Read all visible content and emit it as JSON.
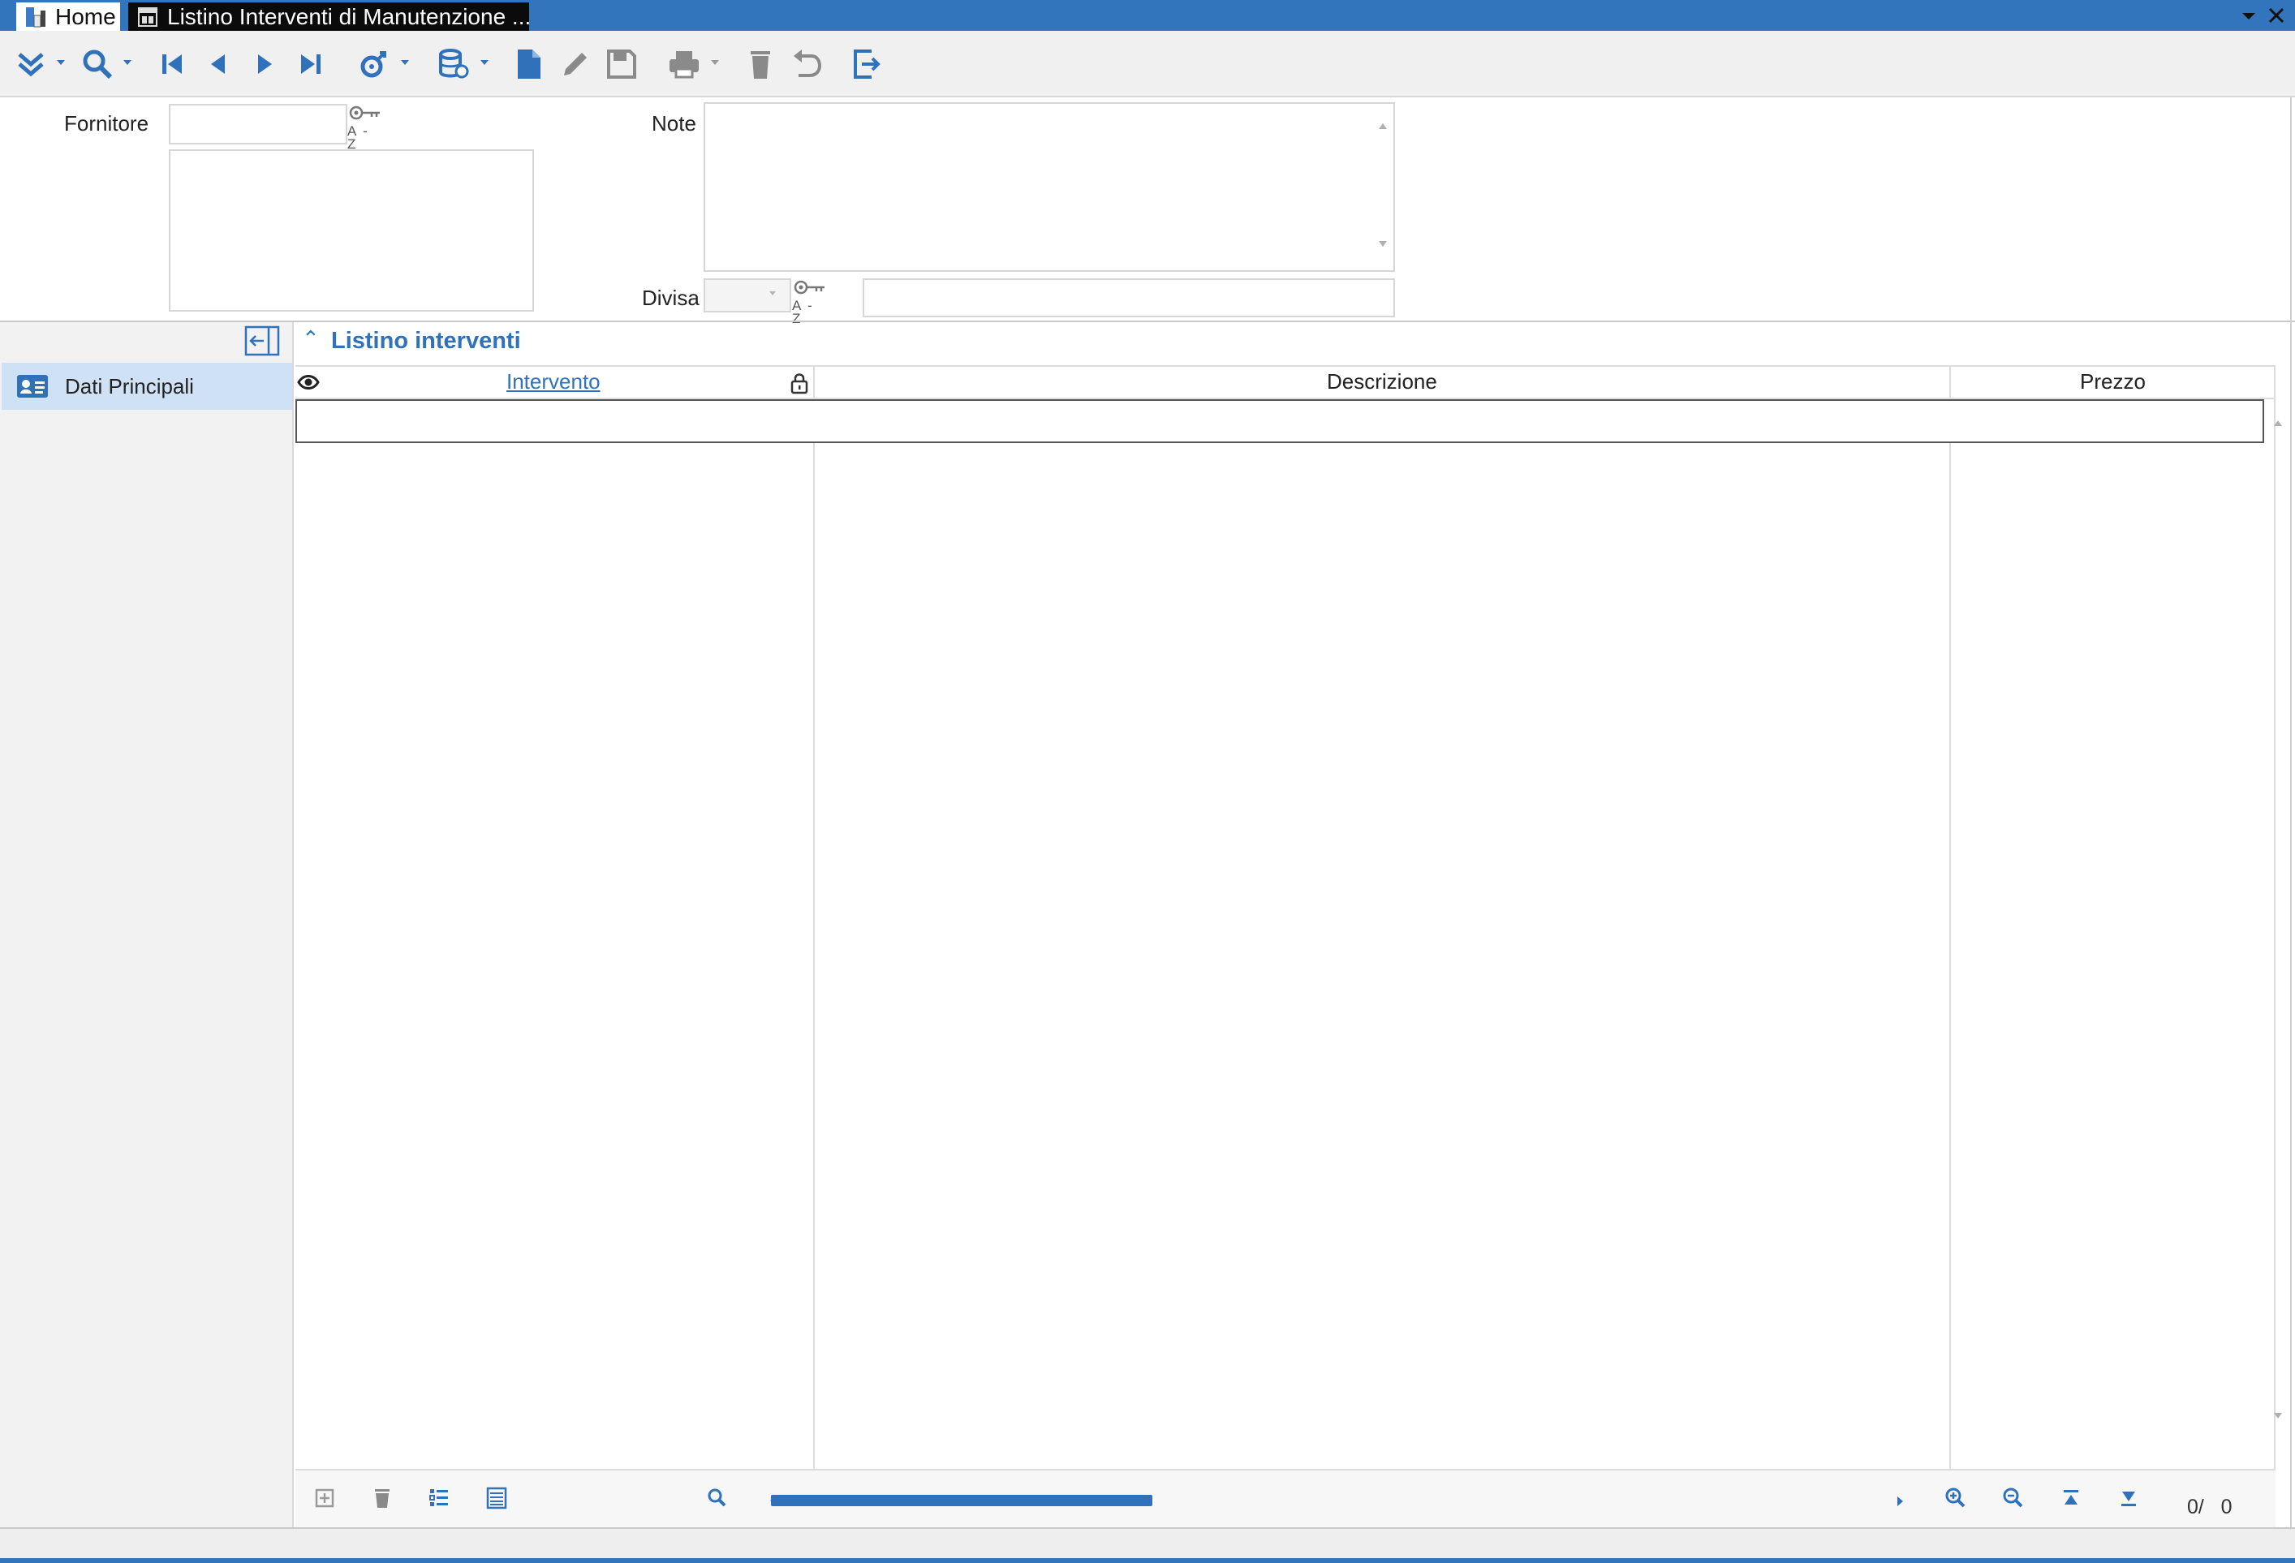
{
  "tabs": {
    "home_label": "Home",
    "window_label": "Listino Interventi di Manutenzione ..."
  },
  "toolbar": {
    "icons": [
      "expand-icon",
      "search-icon",
      "first-record-icon",
      "previous-record-icon",
      "next-record-icon",
      "last-record-icon",
      "link-icon",
      "database-icon",
      "new-document-icon",
      "edit-icon",
      "save-icon",
      "print-icon",
      "delete-icon",
      "undo-icon",
      "exit-icon"
    ]
  },
  "form": {
    "fornitore_label": "Fornitore",
    "fornitore_value": "",
    "fornitore_description": "",
    "note_label": "Note",
    "note_value": "",
    "divisa_label": "Divisa",
    "divisa_value": "",
    "divisa_description": "",
    "az_label": "A - Z"
  },
  "sidebar": {
    "items": [
      {
        "label": "Dati Principali"
      }
    ]
  },
  "section": {
    "title": "Listino interventi"
  },
  "grid": {
    "columns": [
      "Intervento",
      "Descrizione",
      "Prezzo"
    ],
    "rows": []
  },
  "footer": {
    "counter": "0/   0"
  },
  "colors": {
    "accent": "#3275bd",
    "selection": "#cfe1f5",
    "tab_active_bg": "#0b0b0b"
  }
}
